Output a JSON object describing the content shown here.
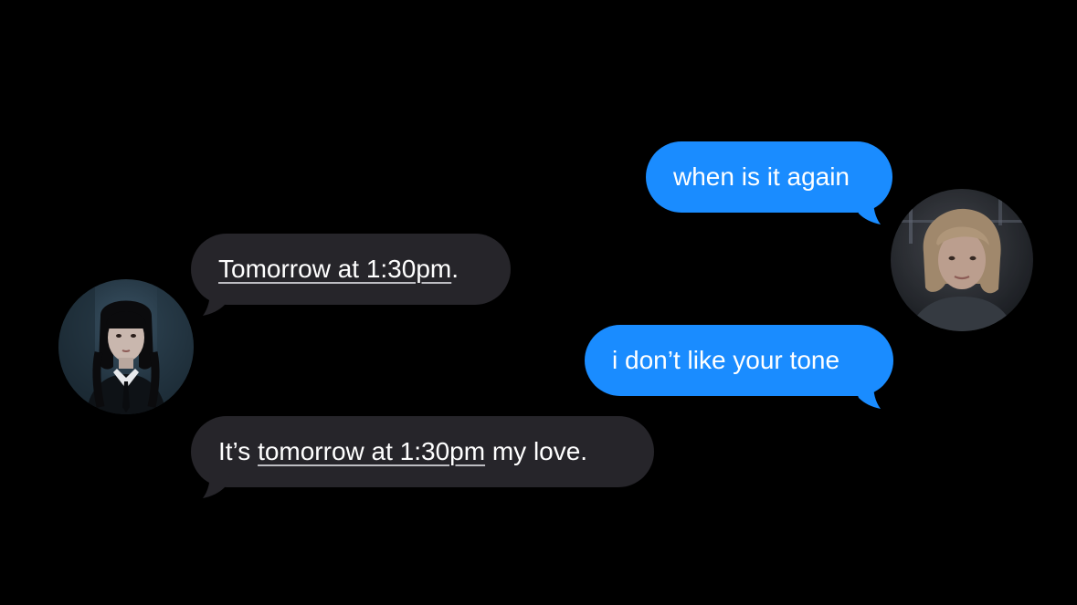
{
  "conversation": {
    "messages": [
      {
        "sender": "me",
        "parts": [
          {
            "text": "when is it again",
            "link": false
          }
        ]
      },
      {
        "sender": "contact",
        "parts": [
          {
            "text": "Tomorrow at 1:30pm",
            "link": true
          },
          {
            "text": ".",
            "link": false
          }
        ]
      },
      {
        "sender": "me",
        "parts": [
          {
            "text": "i don’t like your tone",
            "link": false
          }
        ]
      },
      {
        "sender": "contact",
        "parts": [
          {
            "text": "It’s ",
            "link": false
          },
          {
            "text": "tomorrow at 1:30pm",
            "link": true
          },
          {
            "text": " my love.",
            "link": false
          }
        ]
      }
    ]
  },
  "avatars": {
    "contact": {
      "icon": "avatar-portrait-dark-braids"
    },
    "me": {
      "icon": "avatar-portrait-blonde"
    }
  },
  "colors": {
    "background": "#000000",
    "incoming_bubble": "#26252a",
    "outgoing_bubble": "#1a8cff",
    "text": "#ffffff"
  }
}
